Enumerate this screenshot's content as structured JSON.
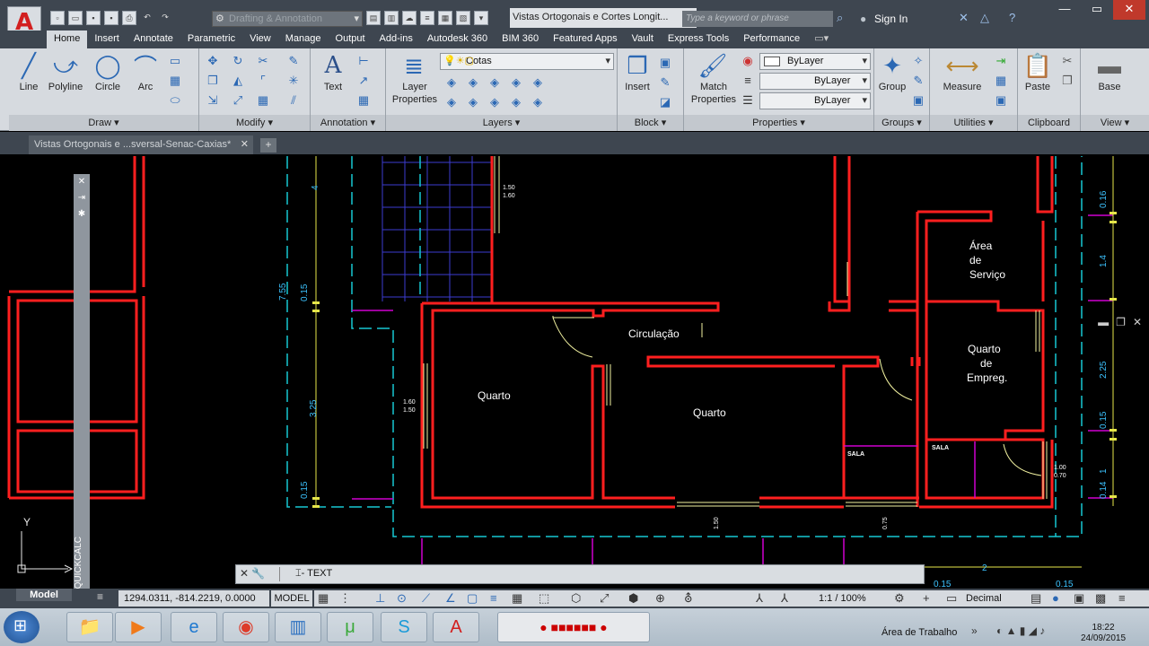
{
  "window": {
    "doc_title": "Vistas Ortogonais e Cortes Longit...",
    "workspace": "Drafting & Annotation",
    "search_placeholder": "Type a keyword or phrase",
    "sign_in": "Sign In"
  },
  "ribbon_tabs": [
    "Home",
    "Insert",
    "Annotate",
    "Parametric",
    "View",
    "Manage",
    "Output",
    "Add-ins",
    "Autodesk 360",
    "BIM 360",
    "Featured Apps",
    "Vault",
    "Express Tools",
    "Performance"
  ],
  "panels": {
    "draw": {
      "title": "Draw",
      "tools": [
        "Line",
        "Polyline",
        "Circle",
        "Arc"
      ]
    },
    "modify": {
      "title": "Modify"
    },
    "annotation": {
      "title": "Annotation",
      "text": "Text"
    },
    "layers": {
      "title": "Layers",
      "layer_properties": "Layer Properties",
      "current_layer": "Cotas"
    },
    "block": {
      "title": "Block",
      "insert": "Insert"
    },
    "properties": {
      "title": "Properties",
      "match": "Match Properties",
      "color": "ByLayer",
      "linetype": "ByLayer",
      "lineweight": "ByLayer"
    },
    "groups": {
      "title": "Groups",
      "group": "Group"
    },
    "utilities": {
      "title": "Utilities",
      "measure": "Measure"
    },
    "clipboard": {
      "title": "Clipboard",
      "paste": "Paste"
    },
    "view": {
      "title": "View",
      "base": "Base"
    }
  },
  "file_tab": "Vistas Ortogonais e ...sversal-Senac-Caxias*",
  "drawing": {
    "rooms": [
      "Quarto",
      "Quarto",
      "Circulação",
      "Área",
      "de",
      "Serviço",
      "Quarto",
      "de",
      "Empreg."
    ],
    "small_labels": [
      "SALA",
      "SALA"
    ],
    "dims": [
      "7.55",
      "0.15",
      "3.25",
      "0.15",
      "4",
      "0.16",
      "1.4",
      "2.25",
      "0.15",
      "1",
      "0.14",
      "1.50",
      "1.60",
      "1.60",
      "1.50",
      "1.00",
      "0.70",
      "1.50",
      "0.75",
      "0.15",
      "2",
      "0.15"
    ]
  },
  "quickcalc": "QUICKCALC",
  "command": {
    "prompt": "TEXT"
  },
  "status": {
    "model_tab": "Model",
    "coords": "1294.0311, -814.2219, 0.0000",
    "model_btn": "MODEL",
    "scale": "1:1 / 100%",
    "units": "Decimal"
  },
  "taskbar": {
    "tray_label": "Área de Trabalho",
    "time": "18:22",
    "date": "24/09/2015"
  }
}
